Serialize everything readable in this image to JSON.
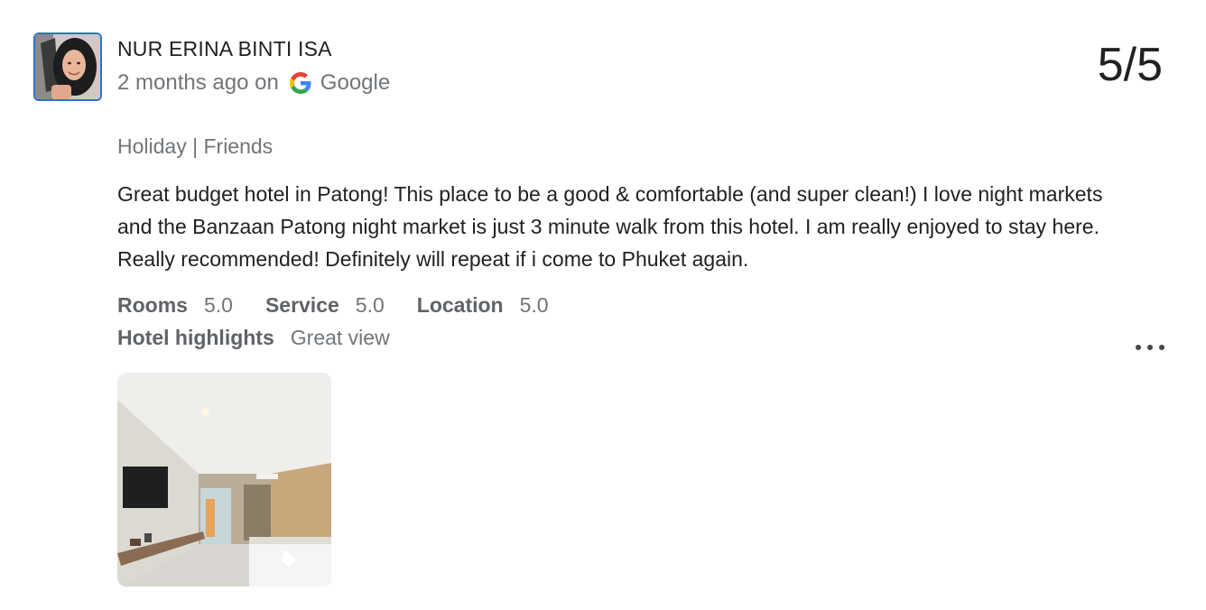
{
  "reviewer": {
    "name": "NUR ERINA BINTI ISA",
    "time": "2 months ago on",
    "source": "Google",
    "source_icon": "google-g-icon"
  },
  "score": "5/5",
  "trip": {
    "type": "Holiday",
    "separator": "|",
    "group": "Friends"
  },
  "review_text": "Great budget hotel in Patong! This place to be a good & comfortable (and super clean!) I love night markets and the Banzaan Patong night market is just 3 minute walk from this hotel. I am really enjoyed to stay here. Really recommended! Definitely will repeat if i come to Phuket again.",
  "ratings": [
    {
      "label": "Rooms",
      "value": "5.0"
    },
    {
      "label": "Service",
      "value": "5.0"
    },
    {
      "label": "Location",
      "value": "5.0"
    }
  ],
  "highlights": {
    "label": "Hotel highlights",
    "value": "Great view"
  },
  "more_icon": "more-horizontal-icon",
  "photos": [
    {
      "icon": "hotel-room-photo"
    }
  ],
  "colors": {
    "avatar_border": "#2f6fd6",
    "primary_text": "#202124",
    "secondary_text": "#70757a",
    "label_text": "#5f6368"
  }
}
